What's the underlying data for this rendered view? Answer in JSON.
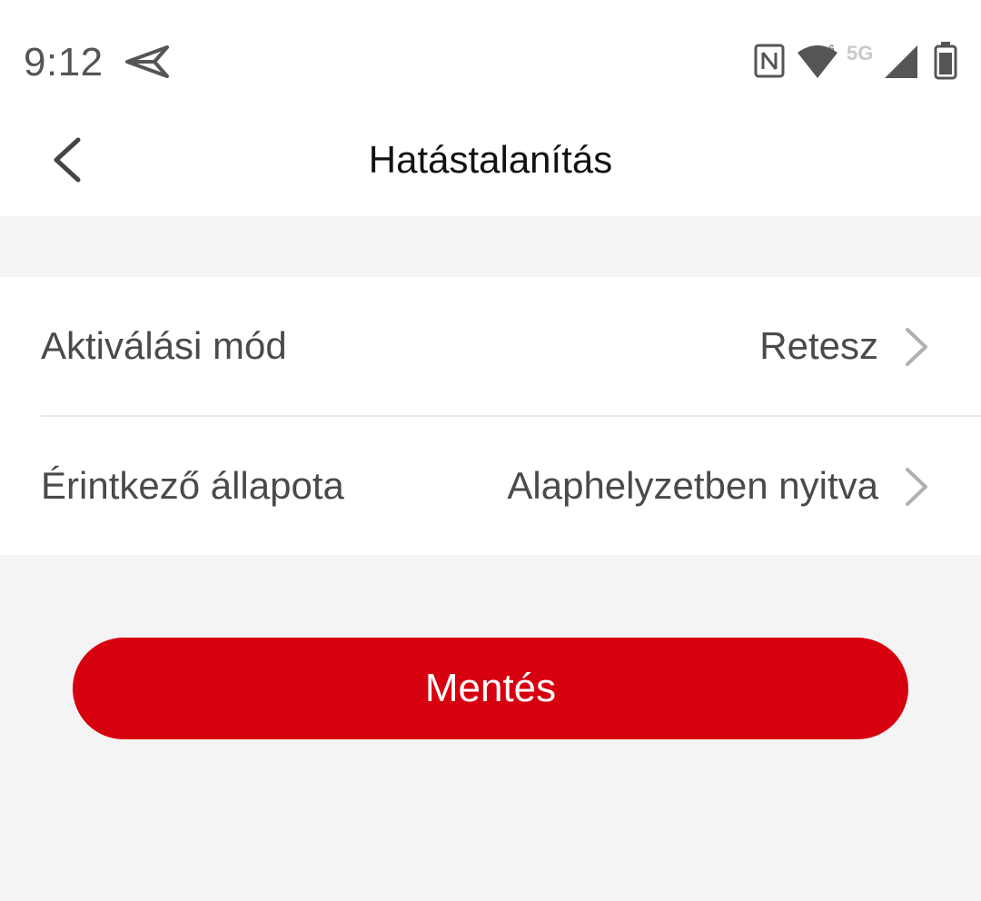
{
  "status_bar": {
    "time": "9:12",
    "network_label": "5G",
    "icons": [
      "send-icon",
      "nfc-icon",
      "wifi-icon",
      "signal-icon",
      "battery-icon"
    ]
  },
  "header": {
    "title": "Hatástalanítás",
    "back_icon": "chevron-left-icon"
  },
  "settings": {
    "rows": [
      {
        "label": "Aktiválási mód",
        "value": "Retesz"
      },
      {
        "label": "Érintkező állapota",
        "value": "Alaphelyzetben nyitva"
      }
    ]
  },
  "actions": {
    "save_label": "Mentés"
  },
  "colors": {
    "accent": "#d7000f",
    "background": "#f4f4f4",
    "surface": "#ffffff",
    "text_primary": "#111111",
    "text_secondary": "#4a4a4a",
    "chevron": "#b0b0b0"
  }
}
